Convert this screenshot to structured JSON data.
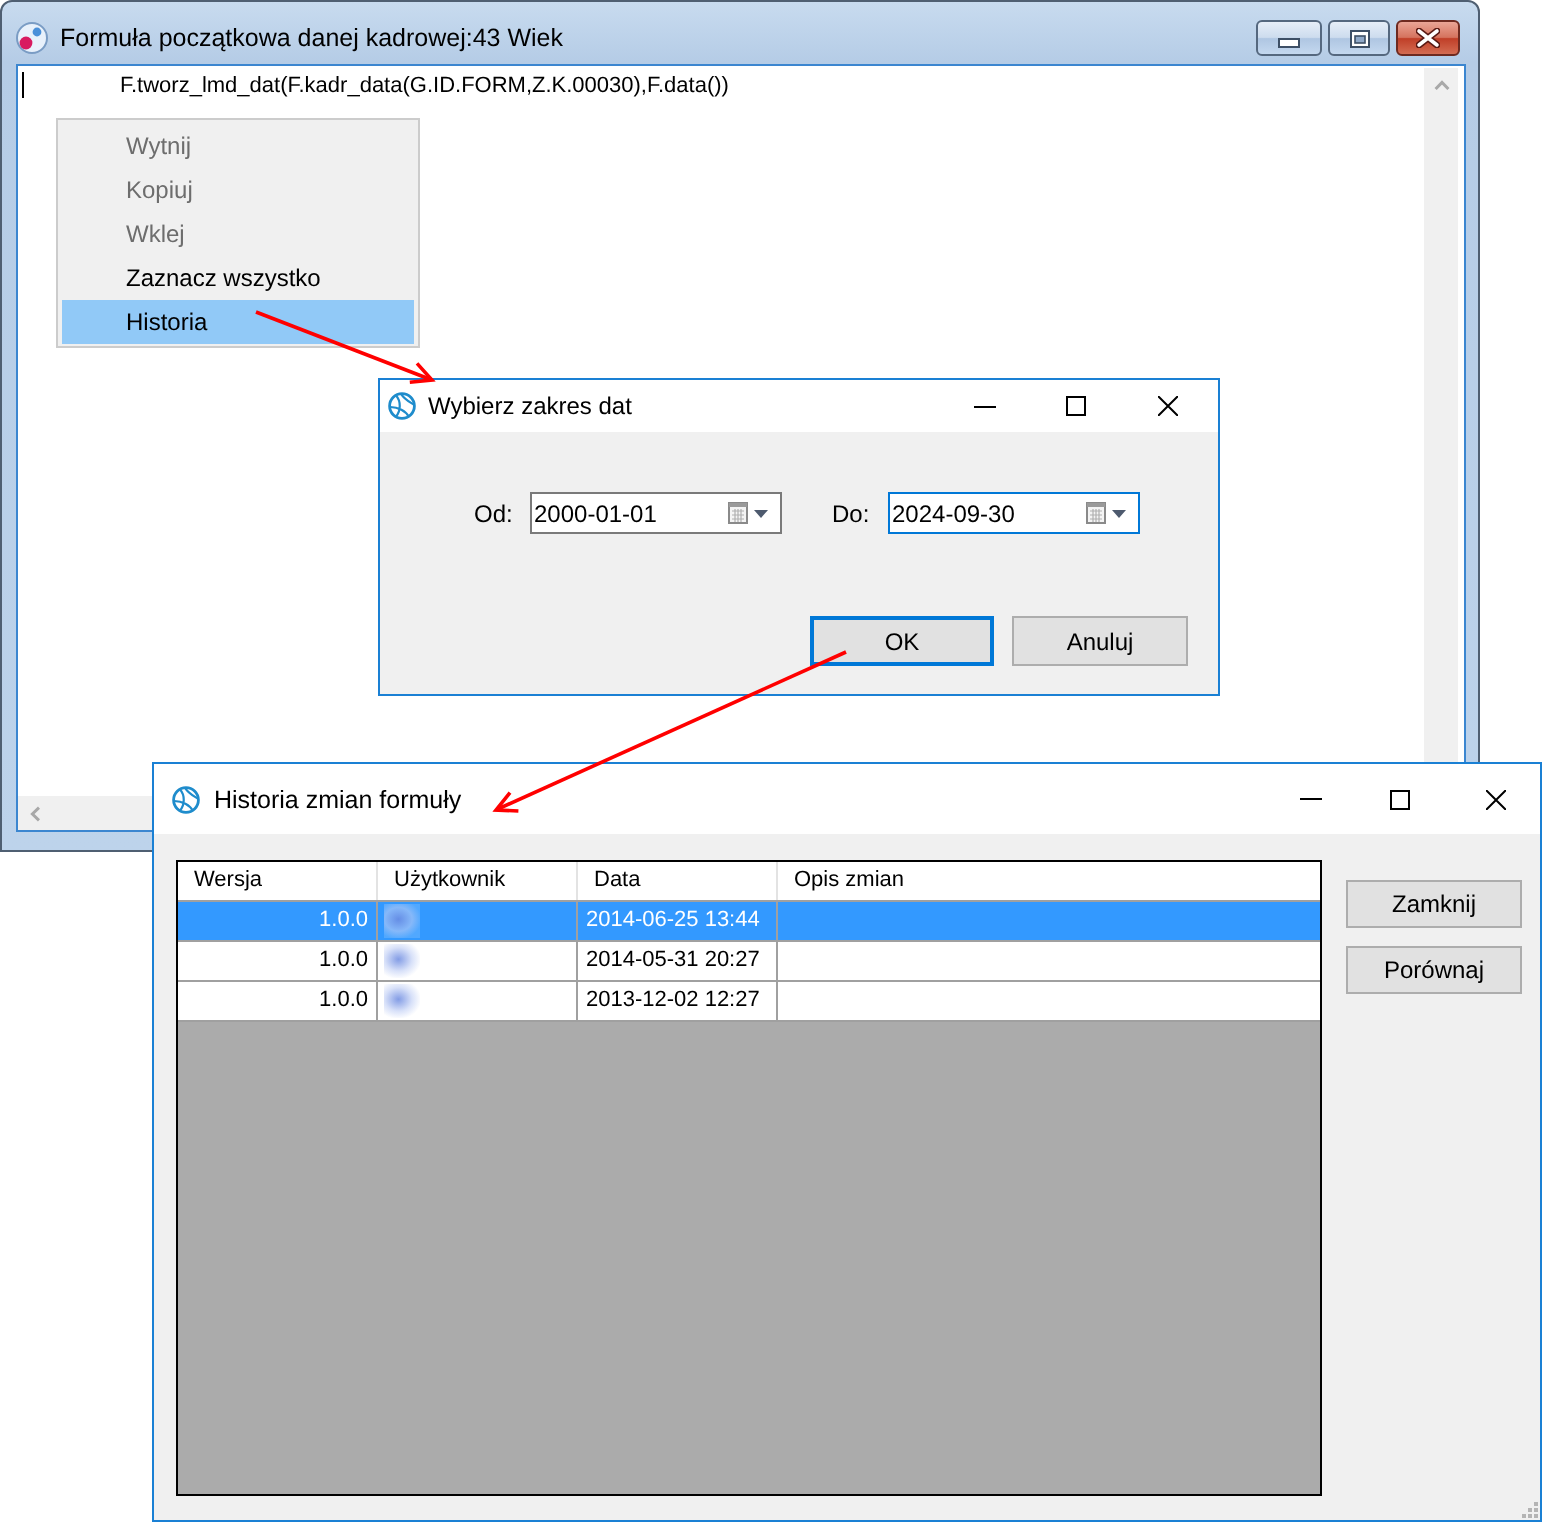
{
  "main_window": {
    "title": "Formuła początkowa danej kadrowej:43 Wiek",
    "editor_text": "F.tworz_lmd_dat(F.kadr_data(G.ID.FORM,Z.K.00030),F.data())"
  },
  "context_menu": {
    "items": [
      {
        "label": "Wytnij",
        "disabled": true,
        "selected": false
      },
      {
        "label": "Kopiuj",
        "disabled": true,
        "selected": false
      },
      {
        "label": "Wklej",
        "disabled": true,
        "selected": false
      },
      {
        "label": "Zaznacz wszystko",
        "disabled": false,
        "selected": false
      },
      {
        "label": "Historia",
        "disabled": false,
        "selected": true
      }
    ]
  },
  "date_dialog": {
    "title": "Wybierz zakres dat",
    "fields": [
      {
        "label": "Od:",
        "value": "2000-01-01",
        "focused": false
      },
      {
        "label": "Do:",
        "value": "2024-09-30",
        "focused": true
      }
    ],
    "buttons": [
      {
        "label": "OK",
        "focused": true
      },
      {
        "label": "Anuluj",
        "focused": false
      }
    ]
  },
  "history_dialog": {
    "title": "Historia zmian formuły",
    "table": {
      "columns": [
        "Wersja",
        "Użytkownik",
        "Data",
        "Opis zmian"
      ],
      "rows": [
        {
          "version": "1.0.0",
          "user_redacted": true,
          "date": "2014-06-25 13:44",
          "selected": true
        },
        {
          "version": "1.0.0",
          "user_redacted": true,
          "date": "2014-05-31 20:27",
          "selected": false
        },
        {
          "version": "1.0.0",
          "user_redacted": true,
          "date": "2013-12-02 12:27",
          "selected": false
        }
      ]
    },
    "buttons": [
      "Zamknij",
      "Porównaj"
    ]
  }
}
